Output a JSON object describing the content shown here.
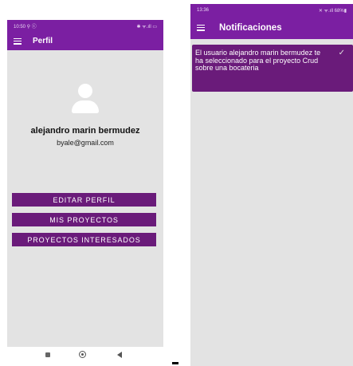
{
  "screen1": {
    "status": {
      "time": "10:50 ⚲ ⓒ",
      "icons": "✱ ᯤ.ıll ▭"
    },
    "appbar": {
      "title": "Perfil"
    },
    "profile": {
      "name": "alejandro marin bermudez",
      "email": "byale@gmail.com"
    },
    "buttons": [
      "EDITAR PERFIL",
      "MIS PROYECTOS",
      "PROYECTOS INTERESADOS"
    ],
    "accent": "#7b1fa2",
    "button_color": "#6a1b7a"
  },
  "screen2": {
    "status": {
      "time": "13:36",
      "icons": "✕ ᯤ.ıll 68%▮"
    },
    "appbar": {
      "title": "Notificaciones"
    },
    "notification": {
      "text": "El usuario alejandro marin bermudez te ha seleccionado para el proyecto Crud sobre una bocateria",
      "icon": "check-icon"
    }
  }
}
